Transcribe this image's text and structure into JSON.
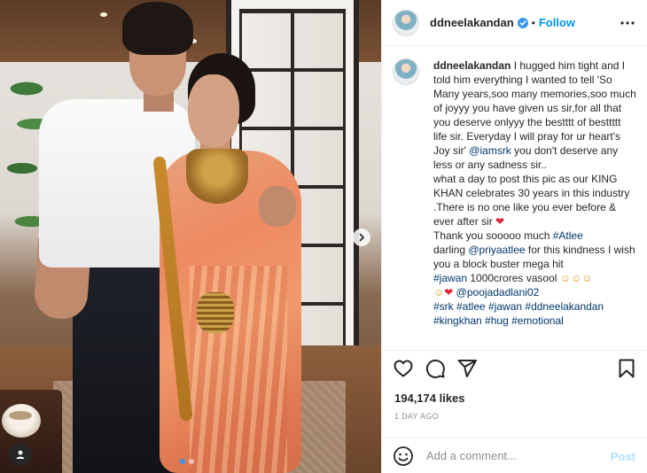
{
  "post": {
    "username": "ddneelakandan",
    "separator": "•",
    "follow_label": "Follow",
    "verified": true
  },
  "caption": {
    "username": "ddneelakandan",
    "part1": " I hugged him tight and I told him everything I wanted to tell 'So Many years,soo many memories,soo much of joyyy you have given us sir,for all that you deserve onlyyy the bestttt of besttttt life sir. Everyday I will pray for ur heart's Joy sir' ",
    "mention_iamsrk": "@iamsrk",
    "part2": " you don't deserve any less or any sadness sir..\nwhat a day to post this pic as our KING KHAN celebrates 30 years in this industry .There is no one like you ever before & ever after sir ",
    "heart": "❤",
    "part3": "\nThank you sooooo much ",
    "tag_atlee": "#Atlee",
    "part4": "\ndarling ",
    "mention_priyaatlee": "@priyaatlee",
    "part5": " for this kindness I wish you a block buster mega hit\n",
    "tag_jawan": "#jawan",
    "part6": " 1000crores vasool ",
    "emojis1": "☺☺☺",
    "part7": "\n",
    "emojis2": "☺",
    "heart2": "❤",
    "part8": " ",
    "mention_pooja": "@poojadadlani02",
    "part9": "\n",
    "hashtags_line1": "#srk #atlee #jawan #ddneelakandan",
    "part10": "\n",
    "hashtags_line2": "#kingkhan #hug #emotional"
  },
  "stats": {
    "likes": "194,174 likes",
    "timestamp": "1 DAY AGO"
  },
  "comment": {
    "placeholder": "Add a comment...",
    "post_label": "Post"
  },
  "carousel": {
    "total": 2,
    "current": 1
  },
  "icons": {
    "like": "heart-outline-icon",
    "comment": "speech-bubble-icon",
    "share": "paper-plane-icon",
    "save": "bookmark-icon",
    "more": "three-dots-icon",
    "emoji": "smiley-icon",
    "next": "chevron-right-icon",
    "tag": "user-tag-icon"
  },
  "colors": {
    "accent": "#0095f6",
    "link": "#00376b",
    "heart": "#e0263a",
    "muted": "#8e8e8e"
  }
}
